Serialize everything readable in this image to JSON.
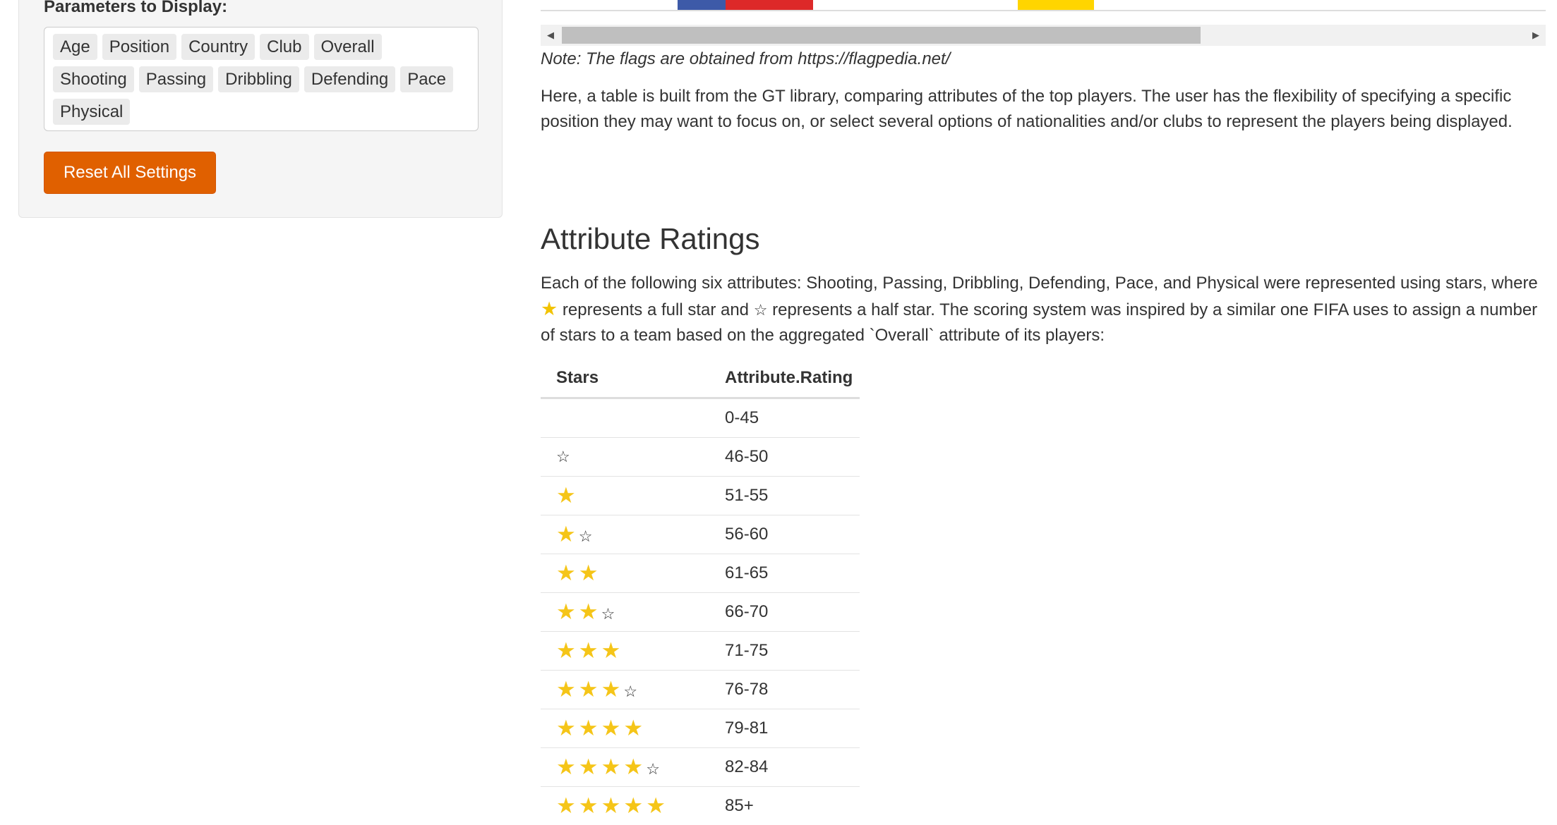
{
  "sidebar": {
    "params_label": "Parameters to Display:",
    "params_rows": [
      [
        "Age",
        "Position",
        "Country",
        "Club",
        "Overall"
      ],
      [
        "Shooting",
        "Passing",
        "Dribbling",
        "Defending",
        "Pace"
      ],
      [
        "Physical"
      ]
    ],
    "reset_label": "Reset All Settings",
    "reset_color": "#e06000"
  },
  "main": {
    "flags_colors": [
      "#3d5aa8",
      "#dd2929",
      "#ffd500"
    ],
    "note": "Note: The flags are obtained from https://flagpedia.net/",
    "intro": "Here, a table is built from the GT library, comparing attributes of the top players. The user has the flexibility of specifying a specific position they may want to focus on, or select several options of nationalities and/or clubs to represent the players being displayed.",
    "section_title": "Attribute Ratings",
    "desc_part1": "Each of the following six attributes: Shooting, Passing, Dribbling, Defending, Pace, and Physical were represented using stars, where",
    "desc_part2": "represents a full star and",
    "desc_part3": "represents a half star. The scoring system was inspired by a similar one FIFA uses to assign a number of stars to a team based on the aggregated `Overall` attribute of its players:",
    "full_star_glyph": "★",
    "half_star_glyph": "☆",
    "star_color": "#f5c518",
    "table": {
      "headers": [
        "Stars",
        "Attribute.Rating"
      ],
      "rows": [
        {
          "full": 0,
          "half": false,
          "rating": "0-45"
        },
        {
          "full": 0,
          "half": true,
          "rating": "46-50"
        },
        {
          "full": 1,
          "half": false,
          "rating": "51-55"
        },
        {
          "full": 1,
          "half": true,
          "rating": "56-60"
        },
        {
          "full": 2,
          "half": false,
          "rating": "61-65"
        },
        {
          "full": 2,
          "half": true,
          "rating": "66-70"
        },
        {
          "full": 3,
          "half": false,
          "rating": "71-75"
        },
        {
          "full": 3,
          "half": true,
          "rating": "76-78"
        },
        {
          "full": 4,
          "half": false,
          "rating": "79-81"
        },
        {
          "full": 4,
          "half": true,
          "rating": "82-84"
        },
        {
          "full": 5,
          "half": false,
          "rating": "85+"
        }
      ]
    }
  }
}
